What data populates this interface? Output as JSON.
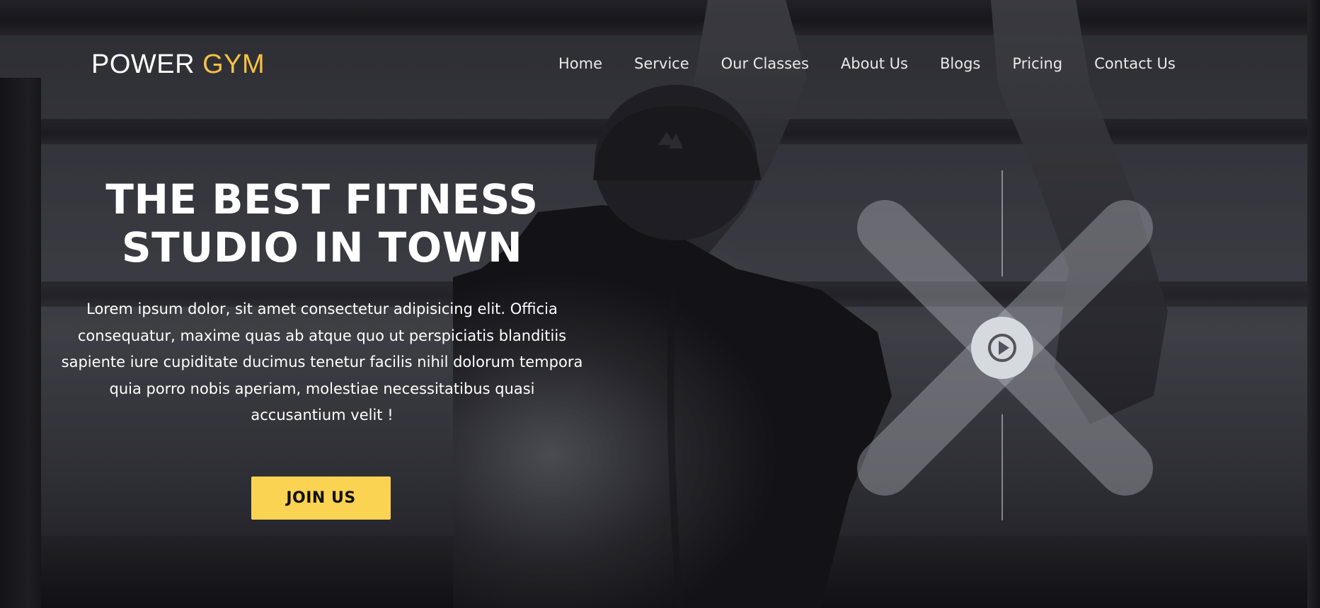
{
  "brand": {
    "word1": "POWER",
    "word2": "GYM",
    "accent_color": "#f7c244"
  },
  "nav": {
    "items": [
      {
        "label": "Home"
      },
      {
        "label": "Service"
      },
      {
        "label": "Our Classes"
      },
      {
        "label": "About Us"
      },
      {
        "label": "Blogs"
      },
      {
        "label": "Pricing"
      },
      {
        "label": "Contact Us"
      }
    ]
  },
  "hero": {
    "headline_line1": "THE BEST FITNESS",
    "headline_line2": "STUDIO IN TOWN",
    "description": "Lorem ipsum dolor, sit amet consectetur adipisicing elit. Officia consequatur, maxime quas ab atque quo ut perspiciatis blanditiis sapiente iure cupiditate ducimus tenetur facilis nihil dolorum tempora quia porro nobis aperiam, molestiae necessitatibus quasi accusantium velit !",
    "cta_label": "JOIN US",
    "cta_color": "#fbd352"
  },
  "video": {
    "play_icon": "play-icon",
    "decor_icon": "x-shape-icon"
  }
}
